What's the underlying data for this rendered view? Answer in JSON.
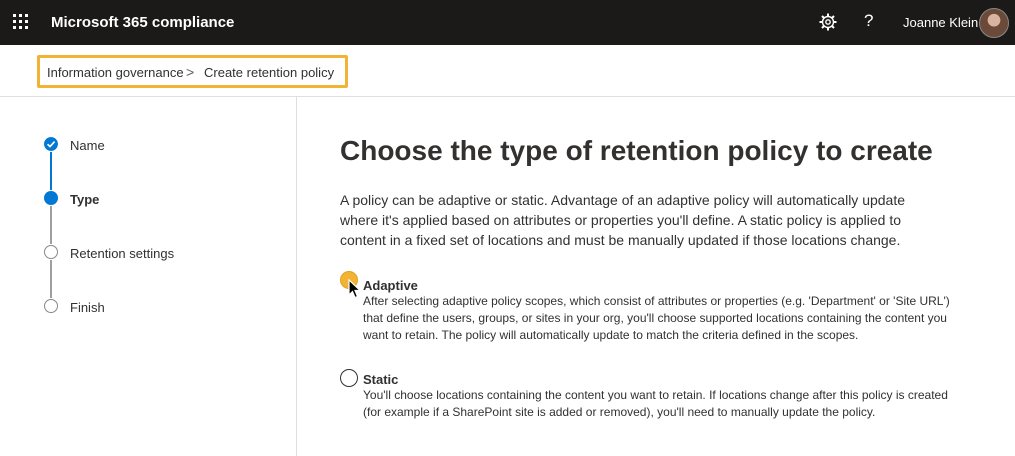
{
  "header": {
    "app_title": "Microsoft 365 compliance",
    "icons": [
      "waffle-icon",
      "gear-icon",
      "help-icon"
    ],
    "help_glyph": "?",
    "user_name": "Joanne Klein",
    "bg_color": "#1b1a19"
  },
  "breadcrumb": {
    "items": [
      "Information governance",
      "Create retention policy"
    ],
    "separator": ">",
    "highlight_color": "#f2b233"
  },
  "wizard": {
    "steps": [
      {
        "label": "Name",
        "state": "completed"
      },
      {
        "label": "Type",
        "state": "current"
      },
      {
        "label": "Retention settings",
        "state": "pending"
      },
      {
        "label": "Finish",
        "state": "pending"
      }
    ],
    "accent_color": "#0078d4"
  },
  "main": {
    "heading": "Choose the type of retention policy to create",
    "description": "A policy can be adaptive or static. Advantage of an adaptive policy will automatically update where it's applied based on attributes or properties you'll define. A static policy is applied to content in a fixed set of locations and must be manually updated if those locations change.",
    "options": [
      {
        "label": "Adaptive",
        "description": "After selecting adaptive policy scopes, which consist of attributes or properties (e.g. 'Department' or 'Site URL') that define the users, groups, or sites in your org, you'll choose supported locations containing the content you want to retain. The policy will automatically update to match the criteria defined in the scopes.",
        "highlighted": true
      },
      {
        "label": "Static",
        "description": "You'll choose locations containing the content you want to retain. If locations change after this policy is created (for example if a SharePoint site is added or removed), you'll need to manually update the policy.",
        "highlighted": false
      }
    ]
  }
}
